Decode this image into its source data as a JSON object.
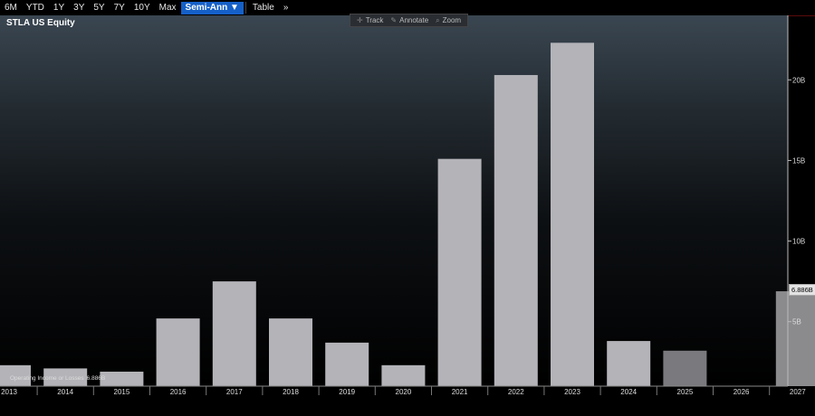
{
  "toolbar": {
    "items": [
      "6M",
      "YTD",
      "1Y",
      "3Y",
      "5Y",
      "7Y",
      "10Y",
      "Max",
      "Semi-Ann ▼",
      "Table",
      "»"
    ],
    "active_index": 8
  },
  "tools": {
    "track": "Track",
    "annotate": "Annotate",
    "zoom": "Zoom"
  },
  "title": "STLA US Equity",
  "legend": {
    "label": "Operating Income or Losses",
    "value": "6.886B"
  },
  "last_value_label": "6.886B",
  "colors": {
    "bar": "#b3b3b8",
    "bar_estimate_dark": "#7a7a7e",
    "bar_estimate_light": "#8b8b8e",
    "toolbar_active": "#1560c8"
  },
  "chart_data": {
    "type": "bar",
    "categories": [
      "2013",
      "2014",
      "2015",
      "2016",
      "2017",
      "2018",
      "2019",
      "2020",
      "2021",
      "2022",
      "2023",
      "2024",
      "2025",
      "2026",
      "2027"
    ],
    "series": [
      {
        "name": "Operating Income or Losses",
        "values": [
          2.3,
          2.1,
          1.9,
          5.2,
          7.5,
          5.2,
          3.7,
          2.3,
          15.1,
          20.3,
          22.3,
          3.8,
          3.2,
          null,
          6.886
        ],
        "estimate": [
          false,
          false,
          false,
          false,
          false,
          false,
          false,
          false,
          false,
          false,
          false,
          false,
          true,
          true,
          true
        ]
      }
    ],
    "yticks": [
      5,
      10,
      15,
      20
    ],
    "ytick_labels": [
      "5B",
      "10B",
      "15B",
      "20B"
    ],
    "ylim": [
      1,
      24
    ],
    "grid": false,
    "legend_position": "bottom-left"
  }
}
